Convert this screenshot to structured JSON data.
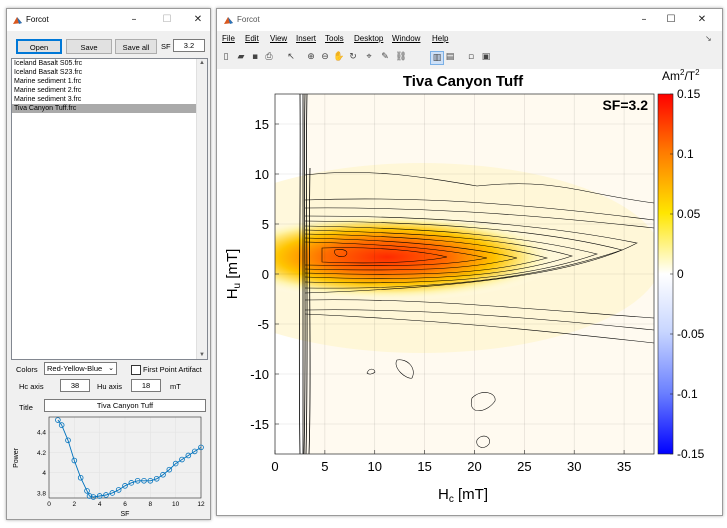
{
  "panel": {
    "title": "Forcot",
    "open_label": "Open",
    "save_label": "Save",
    "save_all_label": "Save all",
    "sf_label": "SF",
    "sf_value": "3.2",
    "files": [
      "Iceland Basalt S05.frc",
      "Iceland Basalt S23.frc",
      "Marine sediment 1.frc",
      "Marine sediment 2.frc",
      "Marine sediment 3.frc",
      "Tiva Canyon Tuff.frc"
    ],
    "selected_file_index": 5,
    "colors_label": "Colors",
    "colors_value": "Red-Yellow-Blue",
    "first_point_label": "First Point Artifact",
    "first_point_checked": false,
    "hc_axis_label": "Hc axis",
    "hc_axis_value": "38",
    "hu_axis_label": "Hu axis",
    "hu_axis_value": "18",
    "axis_unit": "mT",
    "title_label": "Title",
    "title_value": "Tiva Canyon Tuff"
  },
  "figure": {
    "title": "Forcot",
    "menu": [
      "File",
      "Edit",
      "View",
      "Insert",
      "Tools",
      "Desktop",
      "Window",
      "Help"
    ],
    "toolbar_icons": [
      "new-icon",
      "open-folder-icon",
      "save-icon",
      "print-icon",
      "pointer-icon",
      "zoom-in-icon",
      "zoom-out-icon",
      "pan-icon",
      "rotate-icon",
      "data-cursor-icon",
      "brush-icon",
      "link-icon",
      "colorbar-icon",
      "legend-icon",
      "hide-icon",
      "show-icon"
    ]
  },
  "colors": {
    "accent_blue": "#0000ff",
    "accent_red": "#ff0000",
    "zero": "#ffffff"
  },
  "chart_data": [
    {
      "type": "line",
      "xlabel": "SF",
      "ylabel": "Power",
      "xlim": [
        0,
        12
      ],
      "ylim": [
        3.75,
        4.55
      ],
      "x_ticks": [
        0,
        2,
        4,
        6,
        8,
        10,
        12
      ],
      "y_ticks": [
        3.8,
        4,
        4.2,
        4.4
      ],
      "series": [
        {
          "x": [
            0.7,
            1.0,
            1.5,
            2.0,
            2.5,
            3.0,
            3.2,
            3.5,
            4.0,
            4.5,
            5.0,
            5.5,
            6.0,
            6.5,
            7.0,
            7.5,
            8.0,
            8.5,
            9.0,
            9.5,
            10.0,
            10.5,
            11.0,
            11.5,
            12.0
          ],
          "y": [
            4.52,
            4.47,
            4.32,
            4.12,
            3.95,
            3.82,
            3.77,
            3.76,
            3.77,
            3.78,
            3.8,
            3.83,
            3.87,
            3.9,
            3.92,
            3.92,
            3.92,
            3.94,
            3.98,
            4.03,
            4.09,
            4.13,
            4.17,
            4.21,
            4.25
          ]
        }
      ]
    },
    {
      "type": "heatmap",
      "title": "Tiva Canyon Tuff",
      "annotation": "SF=3.2",
      "xlabel": "Hc [mT]",
      "ylabel": "Hu [mT]",
      "xlim": [
        0,
        38
      ],
      "ylim": [
        -18,
        18
      ],
      "x_ticks": [
        0,
        5,
        10,
        15,
        20,
        25,
        30,
        35
      ],
      "y_ticks": [
        -15,
        -10,
        -5,
        0,
        5,
        10,
        15
      ],
      "peak": {
        "hc": 5,
        "hu": 2,
        "value": 0.15
      },
      "colorbar": {
        "label": "Am²/T²",
        "range": [
          -0.15,
          0.15
        ],
        "ticks": [
          "0.15",
          "0.1",
          "0.05",
          "0",
          "-0.05",
          "-0.1",
          "-0.15"
        ],
        "colormap": "Red-Yellow-Blue"
      },
      "grid": true
    }
  ]
}
